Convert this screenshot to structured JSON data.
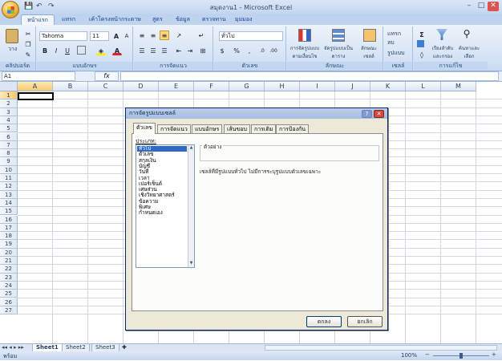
{
  "window": {
    "title": "สมุดงาน1 - Microsoft Excel",
    "min": "–",
    "max": "□",
    "close": "✕"
  },
  "quick_access": [
    "💾",
    "↶",
    "↷"
  ],
  "tabs": [
    "หน้าแรก",
    "แทรก",
    "เค้าโครงหน้ากระดาษ",
    "สูตร",
    "ข้อมูล",
    "ตรวจทาน",
    "มุมมอง"
  ],
  "ribbon": {
    "clipboard": {
      "paste": "วาง",
      "label": "คลิปบอร์ด"
    },
    "font": {
      "name": "Tahoma",
      "size": "11",
      "bold": "B",
      "italic": "I",
      "underline": "U",
      "grow": "A",
      "shrink": "A",
      "color": "A",
      "label": "แบบอักษร"
    },
    "alignment": {
      "label": "การจัดแนว"
    },
    "number": {
      "format": "ทั่วไป",
      "percent": "%",
      "comma": ",",
      "label": "ตัวเลข"
    },
    "styles": {
      "cond": "การจัดรูปแบบตามเงื่อนไข",
      "table": "จัดรูปแบบเป็นตาราง",
      "cell": "ลักษณะเซลล์",
      "label": "ลักษณะ"
    },
    "cells": {
      "insert": "แทรก",
      "delete": "ลบ",
      "format": "รูปแบบ",
      "label": "เซลล์"
    },
    "editing": {
      "sum": "Σ",
      "sort": "เรียงลำดับและกรอง",
      "find": "ค้นหาและเลือก",
      "label": "การแก้ไข"
    }
  },
  "formula_bar": {
    "name_box": "A1",
    "fx": "fx",
    "value": ""
  },
  "grid": {
    "columns": [
      "A",
      "B",
      "C",
      "D",
      "E",
      "F",
      "G",
      "H",
      "I",
      "J",
      "K",
      "L",
      "M"
    ],
    "rows": [
      "1",
      "2",
      "3",
      "4",
      "5",
      "6",
      "7",
      "8",
      "9",
      "10",
      "11",
      "12",
      "13",
      "14",
      "15",
      "16",
      "17",
      "18",
      "19",
      "20",
      "21",
      "22",
      "23",
      "24",
      "25",
      "26",
      "27"
    ],
    "selected_cell": "A1"
  },
  "sheets": [
    "Sheet1",
    "Sheet2",
    "Sheet3"
  ],
  "status": {
    "mode": "พร้อม",
    "zoom": "100%",
    "zoom_minus": "−",
    "zoom_plus": "+"
  },
  "dialog": {
    "title": "การจัดรูปแบบเซลล์",
    "help": "?",
    "close": "✕",
    "tabs": [
      "ตัวเลข",
      "การจัดแนว",
      "แบบอักษร",
      "เส้นขอบ",
      "การเติม",
      "การป้องกัน"
    ],
    "category_label": "ประเภท:",
    "categories": [
      "ทั่วไป",
      "ตัวเลข",
      "สกุลเงิน",
      "บัญชี",
      "วันที่",
      "เวลา",
      "เปอร์เซ็นต์",
      "เศษส่วน",
      "เชิงวิทยาศาสตร์",
      "ข้อความ",
      "พิเศษ",
      "กำหนดเอง"
    ],
    "sample_label": "ตัวอย่าง",
    "sample_value": "",
    "description": "เซลล์ที่มีรูปแบบทั่วไป ไม่มีการระบุรูปแบบตัวเลขเฉพาะ",
    "ok": "ตกลง",
    "cancel": "ยกเลิก"
  }
}
